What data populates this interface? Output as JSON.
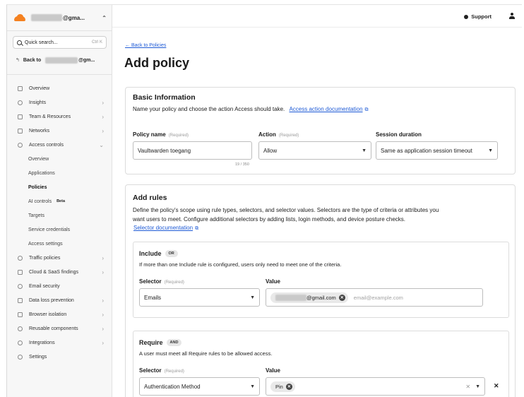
{
  "account": {
    "name_suffix": "@gma...",
    "switcher": "⌃"
  },
  "quick_search": {
    "placeholder": "Quick search...",
    "shortcut": "Ctrl K"
  },
  "back_account": {
    "label": "Back to",
    "suffix": "@gm..."
  },
  "sidebar": {
    "items": [
      {
        "label": "Overview",
        "icon": "overview-icon",
        "arrow": ""
      },
      {
        "label": "Insights",
        "icon": "insights-icon",
        "arrow": "›"
      },
      {
        "label": "Team & Resources",
        "icon": "team-icon",
        "arrow": "›"
      },
      {
        "label": "Networks",
        "icon": "networks-icon",
        "arrow": "›"
      },
      {
        "label": "Access controls",
        "icon": "access-controls-icon",
        "arrow": "⌄"
      }
    ],
    "sub_items": [
      {
        "label": "Overview"
      },
      {
        "label": "Applications"
      },
      {
        "label": "Policies"
      },
      {
        "label": "AI controls",
        "badge": "Beta"
      },
      {
        "label": "Targets"
      },
      {
        "label": "Service credentials"
      },
      {
        "label": "Access settings"
      }
    ],
    "items_after": [
      {
        "label": "Traffic policies",
        "icon": "traffic-policies-icon",
        "arrow": "›"
      },
      {
        "label": "Cloud & SaaS findings",
        "icon": "cloud-findings-icon",
        "arrow": "›"
      },
      {
        "label": "Email security",
        "icon": "email-security-icon",
        "arrow": ""
      },
      {
        "label": "Data loss prevention",
        "icon": "dlp-icon",
        "arrow": "›"
      },
      {
        "label": "Browser isolation",
        "icon": "browser-isolation-icon",
        "arrow": "›"
      },
      {
        "label": "Reusable components",
        "icon": "reusable-components-icon",
        "arrow": "›"
      },
      {
        "label": "Integrations",
        "icon": "integrations-icon",
        "arrow": "›"
      },
      {
        "label": "Settings",
        "icon": "settings-icon",
        "arrow": ""
      }
    ]
  },
  "topbar": {
    "support": "Support"
  },
  "page": {
    "back_link": "← Back to Policies",
    "title": "Add policy"
  },
  "basic_info": {
    "title": "Basic Information",
    "desc": "Name your policy and choose the action Access should take.",
    "doc_link": "Access action documentation",
    "policy_name": {
      "label": "Policy name",
      "required": "(Required)",
      "value": "Vaultwarden toegang",
      "counter": "19 / 350"
    },
    "action": {
      "label": "Action",
      "required": "(Required)",
      "value": "Allow"
    },
    "session": {
      "label": "Session duration",
      "value": "Same as application session timeout"
    }
  },
  "add_rules": {
    "title": "Add rules",
    "desc_line1": "Define the policy's scope using rule types, selectors, and selector values. Selectors are the type of criteria or attributes you",
    "desc_line2": "want users to meet. Configure additional selectors by adding lists, login methods, and device posture checks.",
    "doc_link": "Selector documentation",
    "include": {
      "title": "Include",
      "pill": "OR",
      "desc": "If more than one Include rule is configured, users only need to meet one of the criteria.",
      "selector_label": "Selector",
      "selector_required": "(Required)",
      "selector_value": "Emails",
      "value_label": "Value",
      "chip_suffix": "@gmail.com",
      "placeholder": "email@example.com"
    },
    "require": {
      "title": "Require",
      "pill": "AND",
      "desc": "A user must meet all Require rules to be allowed access.",
      "selector_label": "Selector",
      "selector_required": "(Required)",
      "selector_value": "Authentication Method",
      "value_label": "Value",
      "chip": "Pin"
    }
  }
}
